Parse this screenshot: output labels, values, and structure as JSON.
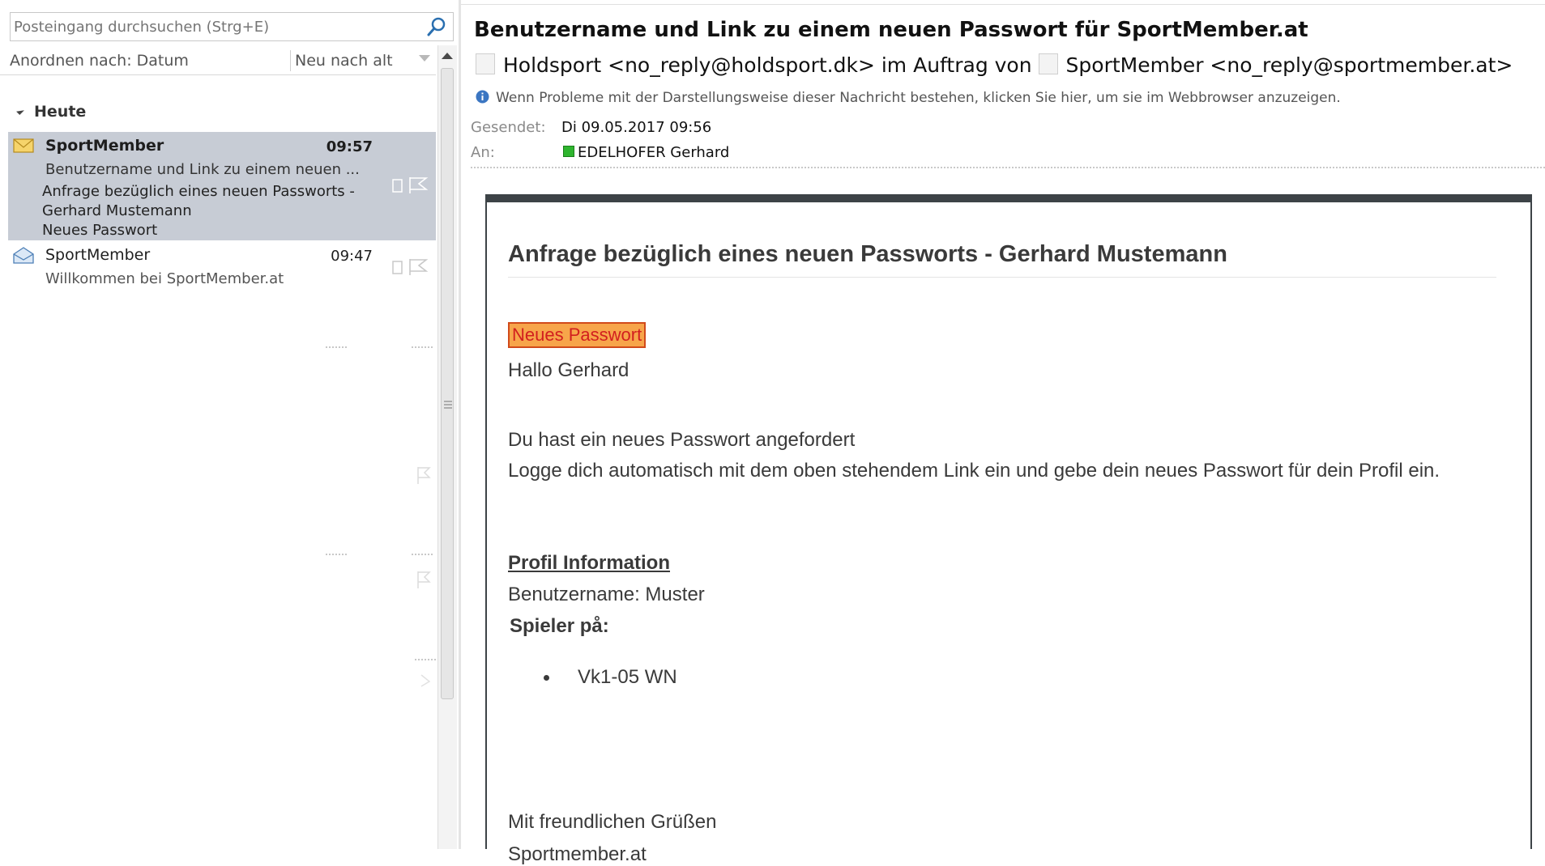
{
  "search": {
    "placeholder": "Posteingang durchsuchen (Strg+E)"
  },
  "sort": {
    "by": "Anordnen nach: Datum",
    "order": "Neu nach alt"
  },
  "groups": [
    {
      "label": "Heute"
    }
  ],
  "mails": [
    {
      "sender": "SportMember",
      "time": "09:57",
      "subject": "Benutzername und Link zu einem neuen ...",
      "preview": [
        "Anfrage bezüglich eines neuen Passworts -",
        "Gerhard Mustemann",
        "Neues Passwort"
      ],
      "unread": true,
      "selected": true
    },
    {
      "sender": "SportMember",
      "time": "09:47",
      "subject": "Willkommen bei SportMember.at",
      "unread": false,
      "selected": false
    }
  ],
  "reading": {
    "title": "Benutzername und Link zu einem neuen Passwort für SportMember.at",
    "from_sender": "Holdsport <no_reply@holdsport.dk>",
    "on_behalf": "im Auftrag von",
    "from_actual": "SportMember <no_reply@sportmember.at>",
    "info_bar": "Wenn Probleme mit der Darstellungsweise dieser Nachricht bestehen, klicken Sie hier, um sie im Webbrowser anzuzeigen.",
    "sent_label": "Gesendet:",
    "sent_value": "Di 09.05.2017 09:56",
    "to_label": "An:",
    "to_value": "EDELHOFER Gerhard"
  },
  "message": {
    "heading": "Anfrage bezüglich eines neuen Passworts - Gerhard Mustemann",
    "button": "Neues Passwort",
    "greeting": "Hallo Gerhard",
    "line1": "Du hast ein neues Passwort angefordert",
    "line2": "Logge dich automatisch mit dem oben stehendem Link ein und gebe dein neues Passwort für dein Profil ein.",
    "profile_heading": "Profil Information",
    "username": "Benutzername: Muster",
    "player_label": "Spieler på:",
    "teams": [
      "Vk1-05 WN"
    ],
    "regards": "Mit freundlichen Grüßen",
    "signature": "Sportmember.at"
  },
  "colors": {
    "selected_row": "#c7ccd5",
    "card_border": "#3d4347",
    "button_bg": "#f7a54a",
    "button_text": "#d21f1f",
    "presence": "#2fb52f"
  }
}
